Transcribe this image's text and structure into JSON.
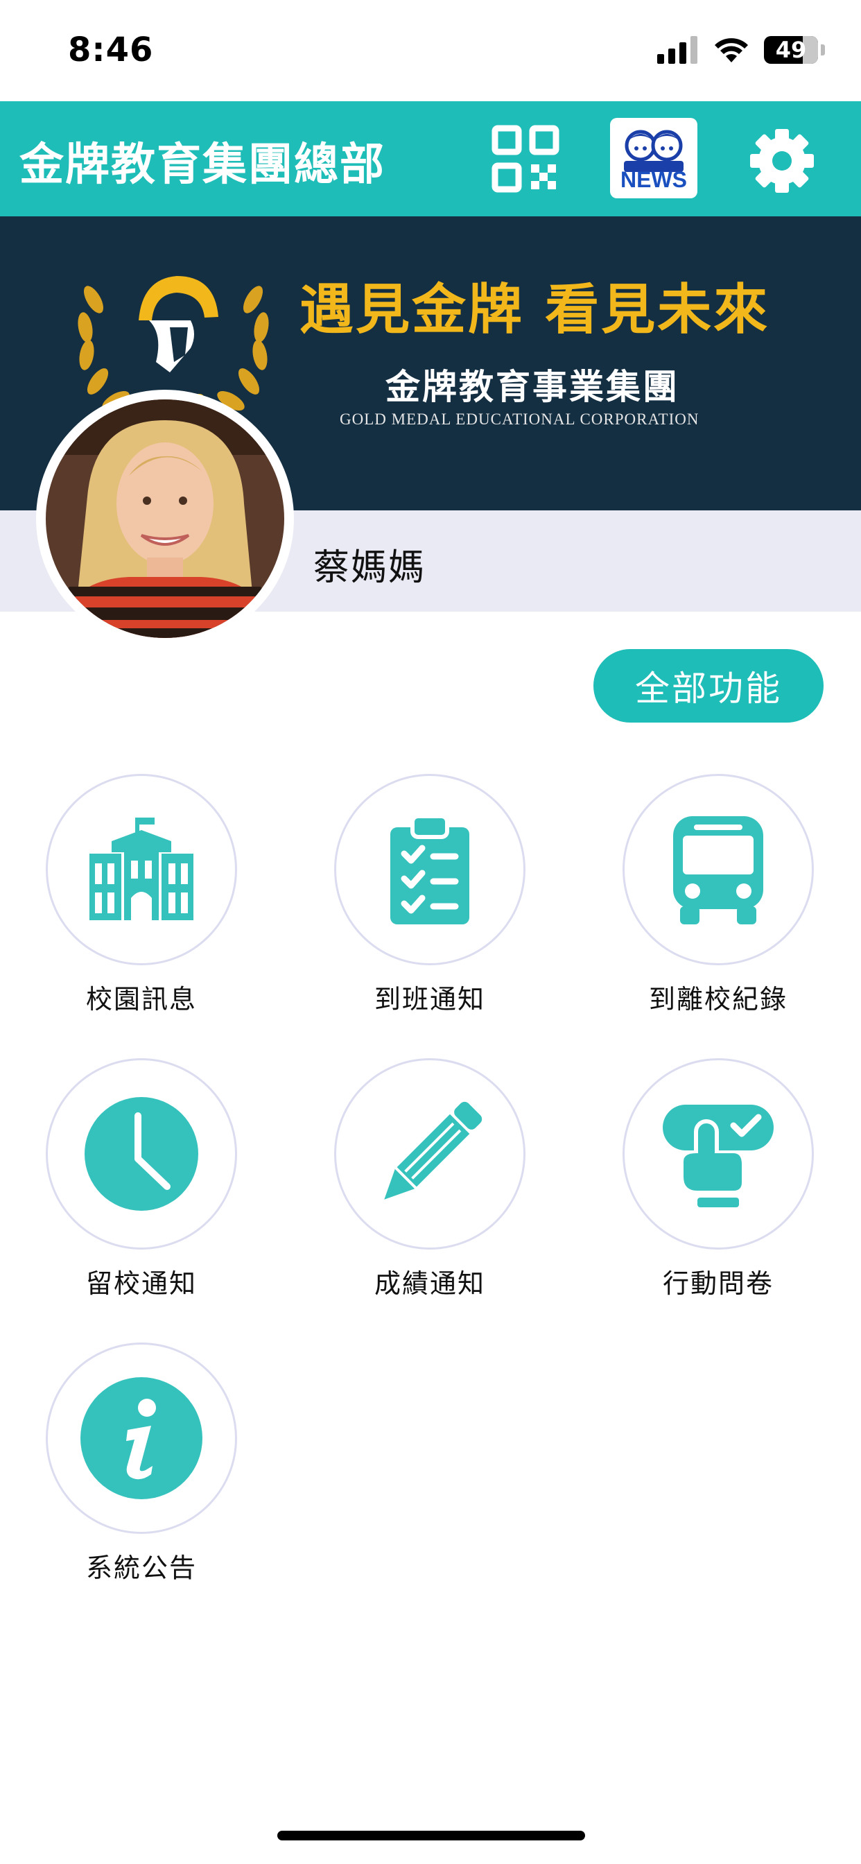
{
  "status_bar": {
    "time": "8:46",
    "battery": "49"
  },
  "header": {
    "title": "金牌教育集團總部",
    "news_label": "NEWS",
    "colors": {
      "brand": "#1fbdb8",
      "banner_bg": "#142e42",
      "gold": "#f2b81b"
    }
  },
  "banner": {
    "slogan": "遇見金牌 看見未來",
    "company_zh": "金牌教育事業集團",
    "company_en": "GOLD MEDAL EDUCATIONAL CORPORATION"
  },
  "profile": {
    "name": "蔡媽媽"
  },
  "all_functions_label": "全部功能",
  "features": [
    {
      "label": "校園訊息",
      "icon": "school-building-icon"
    },
    {
      "label": "到班通知",
      "icon": "clipboard-checklist-icon"
    },
    {
      "label": "到離校紀錄",
      "icon": "bus-icon"
    },
    {
      "label": "留校通知",
      "icon": "clock-icon"
    },
    {
      "label": "成績通知",
      "icon": "pencil-icon"
    },
    {
      "label": "行動問卷",
      "icon": "tap-check-icon"
    },
    {
      "label": "系統公告",
      "icon": "info-icon"
    }
  ]
}
